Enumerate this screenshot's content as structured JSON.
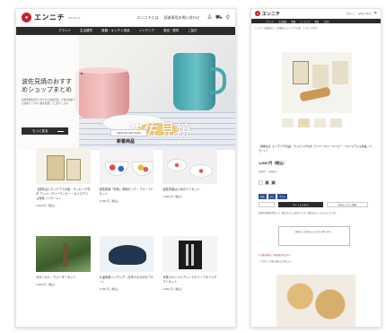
{
  "brand": {
    "name": "エンニチ",
    "sub": "EN-NICHI",
    "accent": "#c8232c"
  },
  "left": {
    "header_links": [
      "エンニチとは",
      "読者専用お問い合わせ"
    ],
    "nav": [
      "ブランド",
      "生活雑貨",
      "食器・キッチン用品",
      "インテリア",
      "食品・飲料",
      "ご紹介"
    ],
    "hero": {
      "title": "波佐見焼のおすすめショップまとめ",
      "desc": "長崎県波佐見町で作られる波佐見焼。手頃な価格で日常使いしやすい器を厳選してご紹介します。",
      "button": "もっと見る",
      "big_jp": "波佐見焼",
      "big_en": "HASAMI-YAKI",
      "more_label": "VIEW ALL ARTICLES"
    },
    "section_title": "新着商品",
    "products": [
      {
        "title": "【送料込】エンデブラの品・ラッピング付き ブンバーマリーワンビー・カリスアジョ商品（ソラーレ）",
        "price": "1,000 円（税込）"
      },
      {
        "title": "波佐見焼「彩色」茶碗ピンク・ブルー＋2セット",
        "price": "2,000 円（税込）"
      },
      {
        "title": "波佐見焼はじめのミニセット",
        "price": "4,250 円（税込）"
      },
      {
        "title": "ボタニカル・ウォーターセット",
        "price": "1,650 円（税込）"
      },
      {
        "title": "久留米絣ハンチング（日本人のびのびブルー）",
        "price": "4,250 円（税込）"
      },
      {
        "title": "天草スペシャルブレンドオリーブオイルギフトセット",
        "price": "3,000 円（税込）"
      }
    ]
  },
  "right": {
    "header_links": [
      "ログイン",
      "お問い合わせ"
    ],
    "nav": [
      "ブランド",
      "生活雑貨",
      "食器",
      "インテリア",
      "食品",
      "ご紹介"
    ],
    "breadcrumb": "トップ ＞ 新着商品 ＞ 【送料込】エンデブラの品・ラッピング付き",
    "title": "【送料込】エンデブラの品・ラッピング付き ブンバーマリーワンビー・カリスアジョ商品（ソラーレ）",
    "price": "1,000 円（税込）",
    "small": "送料別 ・ 在庫あり",
    "tags": [
      "包装",
      "のし",
      "ギフト"
    ],
    "cart_add": "カートに入れる",
    "cart_fav": "お気に入りに追加",
    "text1": "自然の素材を活かした、体にやさしいおやつです。毎日のティータイムにどうぞ。",
    "note": "商品のご注文はこちらから承ります。",
    "red": "※ 送料無料は一部地域を除きます",
    "text2": "一つひとつ丁寧に焼き上げました。"
  }
}
